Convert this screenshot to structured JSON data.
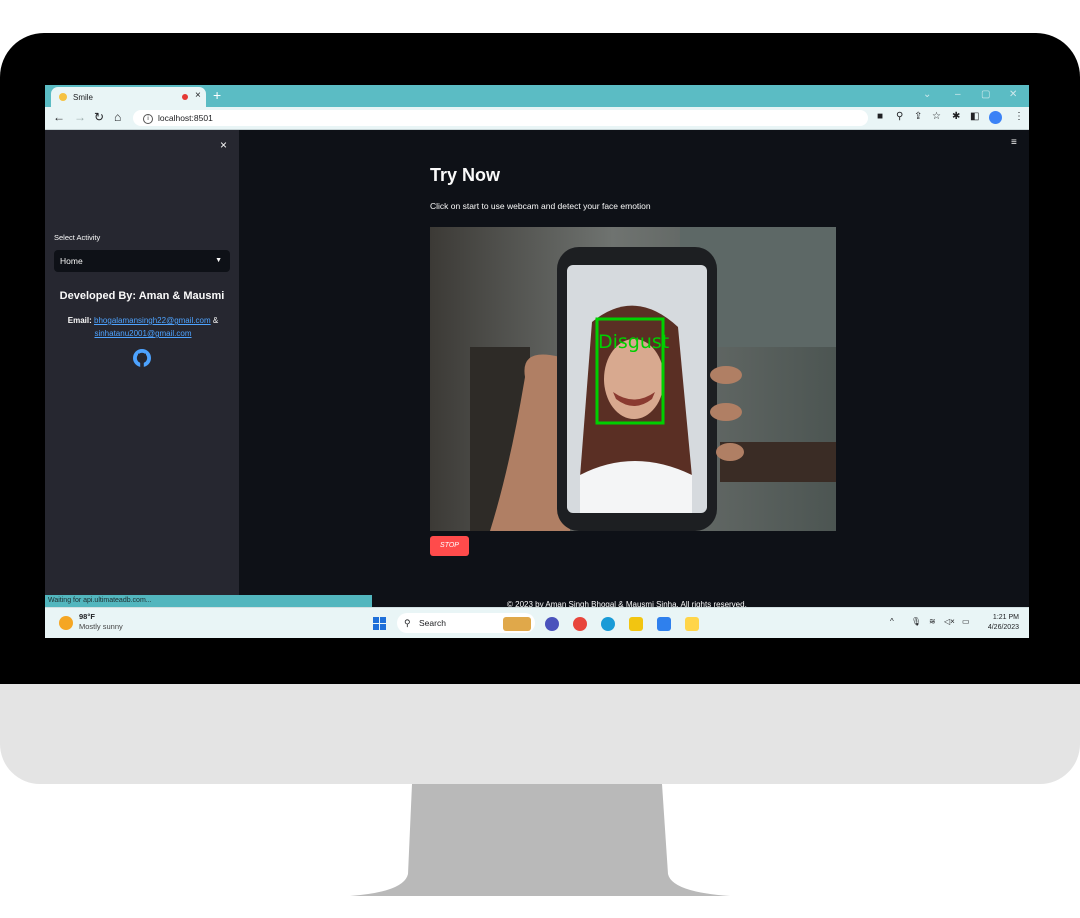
{
  "browser": {
    "tab_title": "Smile",
    "tab_close": "×",
    "new_tab": "+",
    "url": "localhost:8501",
    "window_controls": [
      "⌄",
      "–",
      "▢",
      "✕"
    ]
  },
  "sidebar": {
    "close": "×",
    "select_label": "Select Activity",
    "select_value": "Home",
    "developed_by": "Developed By: Aman & Mausmi",
    "email_label": "Email:",
    "email_1": "bhogalamansingh22@gmail.com",
    "email_sep": "&",
    "email_2": "sinhatanu2001@gmail.com"
  },
  "main": {
    "menu": "≡",
    "title": "Try Now",
    "subtitle": "Click on start to use webcam and detect your face emotion",
    "detection_label": "Disgust",
    "stop_button": "STOP",
    "footer": "© 2023 by Aman Singh Bhogal & Mausmi Sinha. All rights reserved."
  },
  "status_bar": "Waiting for api.ultimateadb.com...",
  "taskbar": {
    "temperature": "98°F",
    "condition": "Mostly sunny",
    "search": "Search",
    "time": "1:21 PM",
    "date": "4/26/2023"
  },
  "colors": {
    "app_bg": "#0e1117",
    "sidebar_bg": "#262730",
    "accent_red": "#ff4b4b",
    "detection_green": "#00d000",
    "browser_teal": "#5bbcc4"
  }
}
